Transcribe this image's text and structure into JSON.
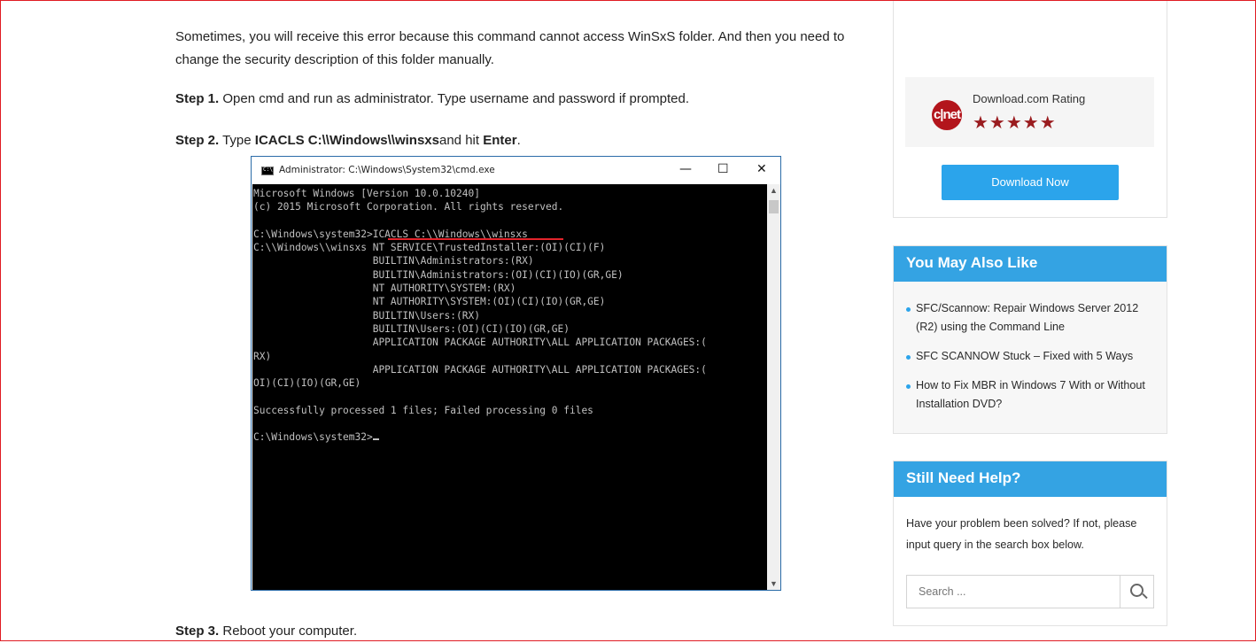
{
  "article": {
    "intro": "Sometimes, you will receive this error because this command cannot access WinSxS folder. And then you need to change the security description of this folder manually.",
    "step1_label": "Step 1.",
    "step1_text": " Open cmd and run as administrator. Type username and password if prompted.",
    "step2_label": "Step 2.",
    "step2_pre": " Type ",
    "step2_cmd": "ICACLS C:\\\\Windows\\\\winsxs",
    "step2_mid": "and hit ",
    "step2_key": "Enter",
    "step2_end": ".",
    "step3_label": "Step 3.",
    "step3_text": " Reboot your computer."
  },
  "cmd_window": {
    "title": "Administrator: C:\\Windows\\System32\\cmd.exe",
    "minimize": "—",
    "maximize": "☐",
    "close": "✕",
    "output": "Microsoft Windows [Version 10.0.10240]\n(c) 2015 Microsoft Corporation. All rights reserved.\n\nC:\\Windows\\system32>ICACLS C:\\\\Windows\\\\winsxs\nC:\\\\Windows\\\\winsxs NT SERVICE\\TrustedInstaller:(OI)(CI)(F)\n                    BUILTIN\\Administrators:(RX)\n                    BUILTIN\\Administrators:(OI)(CI)(IO)(GR,GE)\n                    NT AUTHORITY\\SYSTEM:(RX)\n                    NT AUTHORITY\\SYSTEM:(OI)(CI)(IO)(GR,GE)\n                    BUILTIN\\Users:(RX)\n                    BUILTIN\\Users:(OI)(CI)(IO)(GR,GE)\n                    APPLICATION PACKAGE AUTHORITY\\ALL APPLICATION PACKAGES:(\nRX)\n                    APPLICATION PACKAGE AUTHORITY\\ALL APPLICATION PACKAGES:(\nOI)(CI)(IO)(GR,GE)\n\nSuccessfully processed 1 files; Failed processing 0 files\n\nC:\\Windows\\system32>"
  },
  "sidebar": {
    "rating_logo": "c|net",
    "rating_label": "Download.com Rating",
    "rating_stars": "★★★★★",
    "rating_value": 4.5,
    "star_color": "#9a1c1f",
    "download_button": "Download Now",
    "also_like": {
      "title": "You May Also Like",
      "items": [
        "SFC/Scannow: Repair Windows Server 2012 (R2) using the Command Line",
        "SFC SCANNOW Stuck – Fixed with 5 Ways",
        "How to Fix MBR in Windows 7 With or Without Installation DVD?"
      ]
    },
    "help": {
      "title": "Still Need Help?",
      "text": "Have your problem been solved? If not, please input query in the search box below.",
      "search_placeholder": "Search ..."
    }
  },
  "colors": {
    "accent": "#34a3e3",
    "button": "#2ba4eb",
    "frame": "#e01b22"
  }
}
